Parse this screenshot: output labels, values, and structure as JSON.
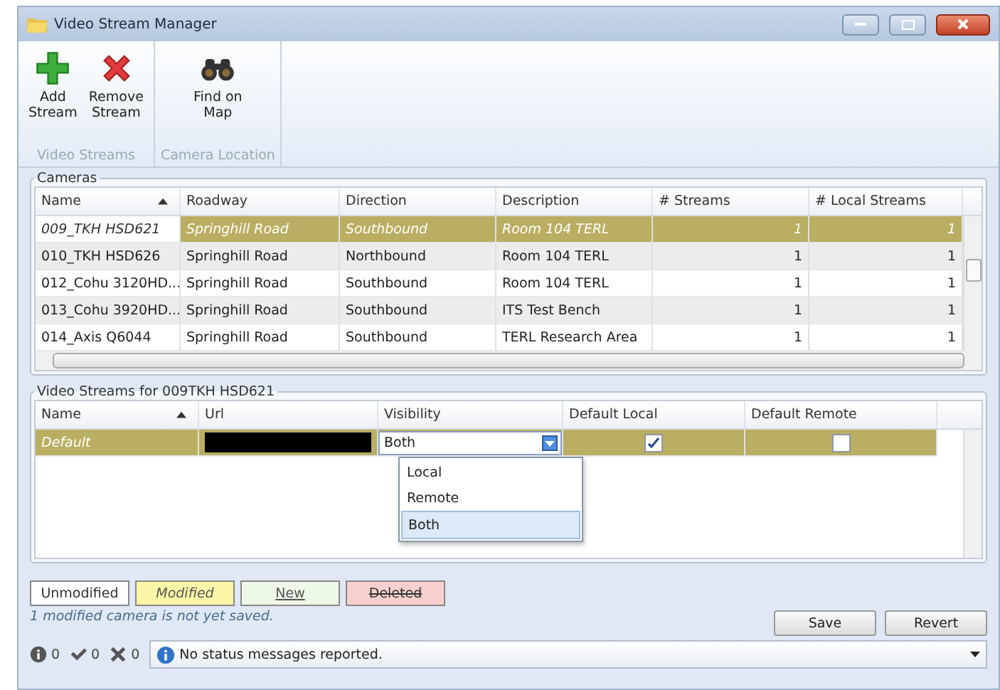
{
  "window": {
    "title": "Video Stream Manager"
  },
  "ribbon": {
    "groups": [
      {
        "label": "Video Streams",
        "buttons": [
          {
            "label": "Add\nStream",
            "kind": "add"
          },
          {
            "label": "Remove\nStream",
            "kind": "remove"
          }
        ]
      },
      {
        "label": "Camera Location",
        "buttons": [
          {
            "label": "Find on\nMap",
            "kind": "find"
          }
        ]
      }
    ]
  },
  "cameras": {
    "title": "Cameras",
    "columns": [
      {
        "label": "Name",
        "sorted": true
      },
      {
        "label": "Roadway",
        "sorted": false
      },
      {
        "label": "Direction",
        "sorted": false
      },
      {
        "label": "Description",
        "sorted": false
      },
      {
        "label": "# Streams",
        "sorted": false
      },
      {
        "label": "# Local Streams",
        "sorted": false
      }
    ],
    "rows": [
      {
        "cells": [
          "009_TKH HSD621",
          "Springhill Road",
          "Southbound",
          "Room 104 TERL",
          "1",
          "1"
        ],
        "selected": true
      },
      {
        "cells": [
          "010_TKH HSD626",
          "Springhill Road",
          "Northbound",
          "Room 104 TERL",
          "1",
          "1"
        ],
        "selected": false
      },
      {
        "cells": [
          "012_Cohu 3120HD...",
          "Springhill Road",
          "Southbound",
          "Room 104 TERL",
          "1",
          "1"
        ],
        "selected": false
      },
      {
        "cells": [
          "013_Cohu 3920HD...",
          "Springhill Road",
          "Southbound",
          "ITS Test Bench",
          "1",
          "1"
        ],
        "selected": false
      },
      {
        "cells": [
          "014_Axis Q6044",
          "Springhill Road",
          "Southbound",
          "TERL Research Area",
          "1",
          "1"
        ],
        "selected": false
      }
    ]
  },
  "streams": {
    "title": "Video Streams for 009TKH HSD621",
    "columns": [
      {
        "label": "Name",
        "sorted": true
      },
      {
        "label": "Url",
        "sorted": false
      },
      {
        "label": "Visibility",
        "sorted": false
      },
      {
        "label": "Default Local",
        "sorted": false
      },
      {
        "label": "Default Remote",
        "sorted": false
      }
    ],
    "rows": [
      {
        "name": "Default",
        "visibility": "Both",
        "default_local": true,
        "default_remote": false,
        "selected": true
      }
    ],
    "dropdown": [
      {
        "label": "Local",
        "selected": false
      },
      {
        "label": "Remote",
        "selected": false
      },
      {
        "label": "Both",
        "selected": true
      }
    ]
  },
  "legend": [
    {
      "label": "Unmodified",
      "kind": "unmodified"
    },
    {
      "label": "Modified",
      "kind": "modified"
    },
    {
      "label": "New",
      "kind": "new"
    },
    {
      "label": "Deleted",
      "kind": "deleted"
    }
  ],
  "save_note": "1 modified camera is not yet saved.",
  "buttons": [
    "Save",
    "Revert"
  ],
  "status_bar": {
    "counts": [
      {
        "kind": "info",
        "count": "0"
      },
      {
        "kind": "ok",
        "count": "0"
      },
      {
        "kind": "error",
        "count": "0"
      }
    ],
    "message": "No status messages reported."
  }
}
